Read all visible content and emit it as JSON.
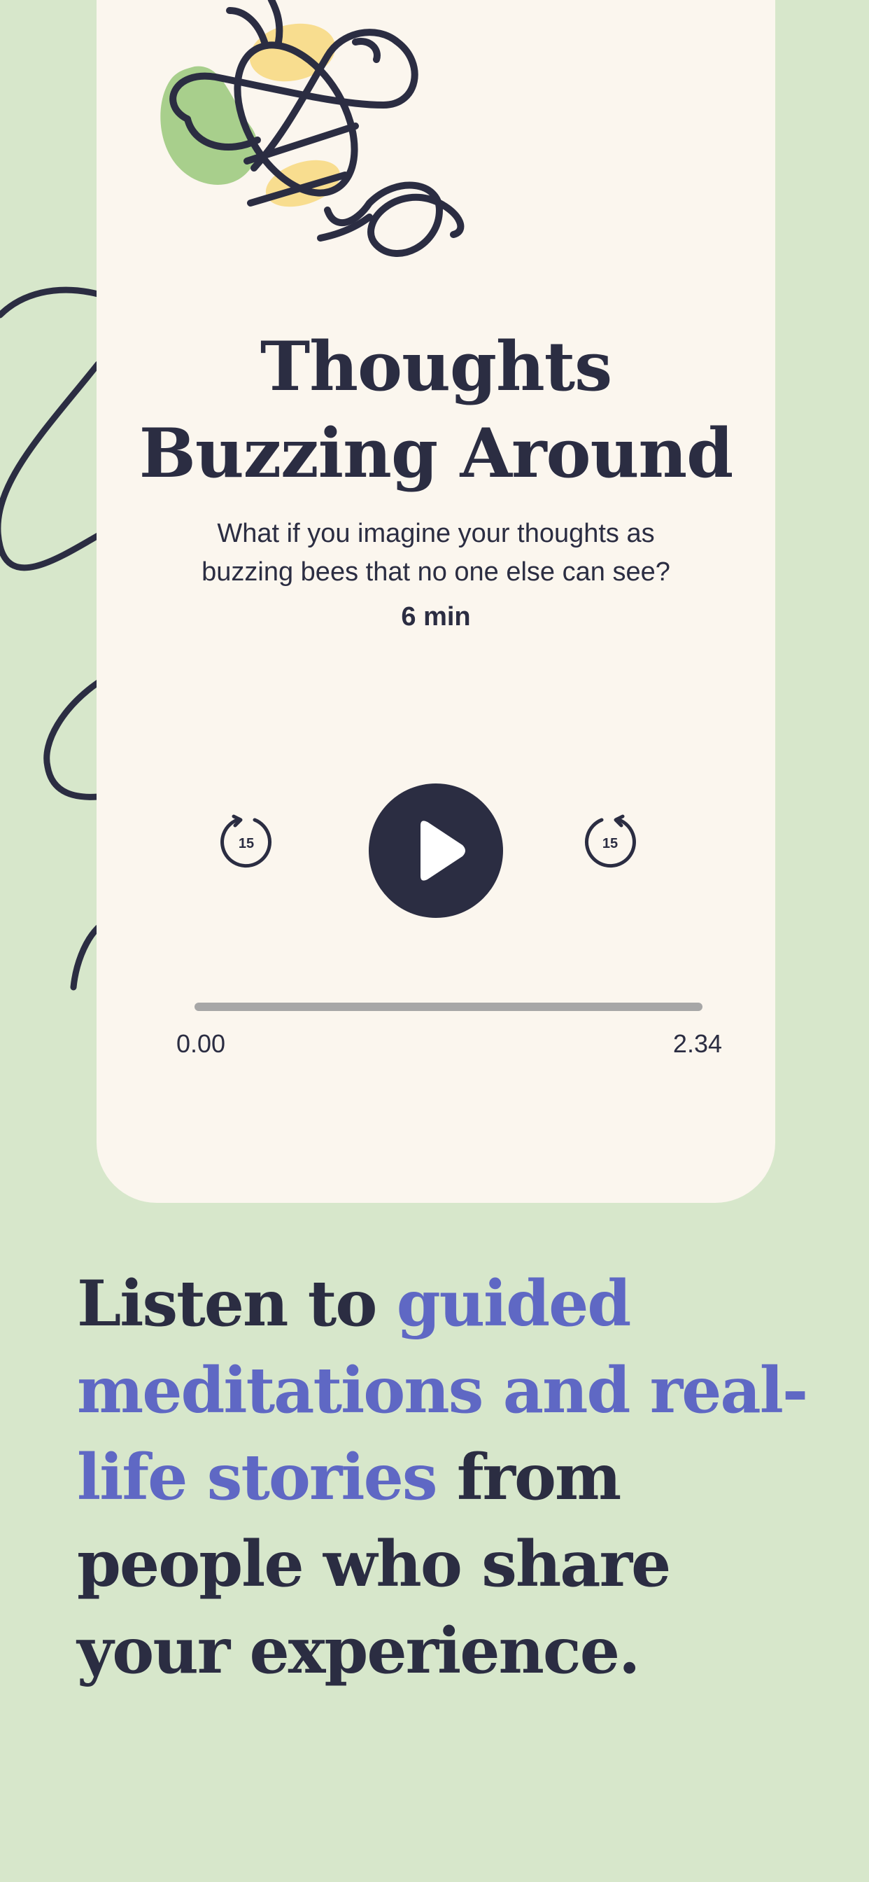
{
  "player": {
    "title_line1": "Thoughts",
    "title_line2": "Buzzing Around",
    "description": "What if you imagine your thoughts as buzzing bees that no one else can see?",
    "duration": "6 min",
    "rewind_seconds": "15",
    "forward_seconds": "15",
    "time_elapsed": "0.00",
    "time_total": "2.34",
    "progress_fraction": 0
  },
  "promo": {
    "text_1": "Listen to ",
    "highlight_1": "guided meditations and real-life stories",
    "text_2": " from people who share your experience."
  },
  "colors": {
    "background": "#d7e7cb",
    "card": "#fbf6ee",
    "dark": "#2b2d42",
    "accent": "#5f68c4",
    "bee_yellow": "#f8dd8f",
    "bee_green": "#a8cf8c"
  },
  "icons": {
    "bee": "bee-illustration",
    "play": "play-icon",
    "rewind": "rewind-15-icon",
    "forward": "forward-15-icon"
  }
}
